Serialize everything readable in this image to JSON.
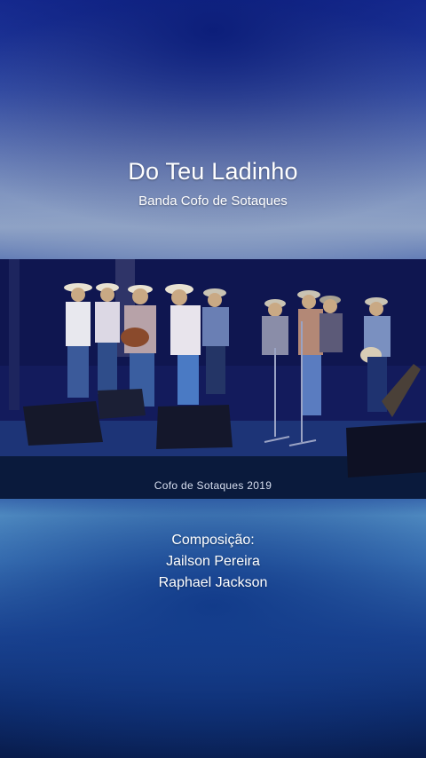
{
  "video_title": "Do Teu Ladinho",
  "band": "Banda Cofo de Sotaques",
  "photo_caption": "Cofo de Sotaques 2019",
  "credits": {
    "heading": "Composição:",
    "composers": [
      "Jailson Pereira",
      "Raphael Jackson"
    ]
  },
  "colors": {
    "top": "#1a2f9a",
    "mid": "#8ea2c6",
    "stage": "#1a1f6a",
    "bottom": "#081c4c"
  }
}
